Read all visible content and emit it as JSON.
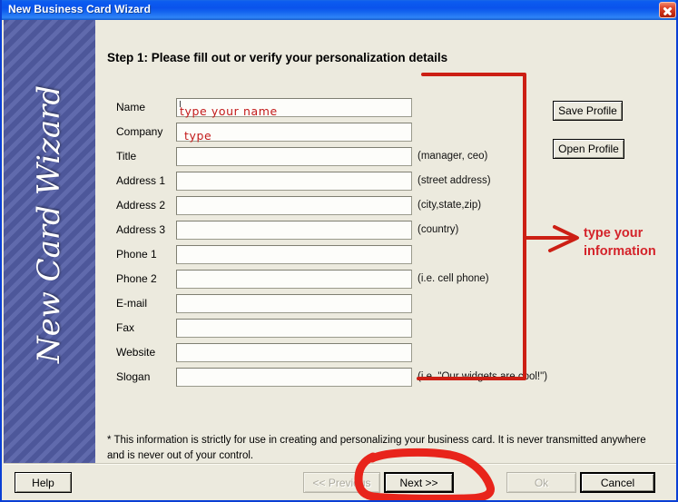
{
  "window": {
    "title": "New Business Card Wizard",
    "close_icon": "close-icon",
    "sidebar_title": "New Card Wizard",
    "accent_titlebar": "#0a53ec",
    "accent_annotation": "#d4232a",
    "panel_bg": "#eceade",
    "sidebar_bg": "#535ea6"
  },
  "main": {
    "step_heading": "Step 1:  Please fill out or verify your personalization details",
    "footnote": "* This information is strictly for use in creating and personalizing your business card.  It is never transmitted anywhere and is never out of your control."
  },
  "form": {
    "fields": [
      {
        "label": "Name",
        "value": "",
        "placeholder": "",
        "hint": ""
      },
      {
        "label": "Company",
        "value": "",
        "placeholder": "",
        "hint": ""
      },
      {
        "label": "Title",
        "value": "",
        "placeholder": "",
        "hint": "(manager, ceo)"
      },
      {
        "label": "Address 1",
        "value": "",
        "placeholder": "",
        "hint": "(street address)"
      },
      {
        "label": "Address 2",
        "value": "",
        "placeholder": "",
        "hint": "(city,state,zip)"
      },
      {
        "label": "Address 3",
        "value": "",
        "placeholder": "",
        "hint": "(country)"
      },
      {
        "label": "Phone 1",
        "value": "",
        "placeholder": "",
        "hint": ""
      },
      {
        "label": "Phone 2",
        "value": "",
        "placeholder": "",
        "hint": "(i.e. cell phone)"
      },
      {
        "label": "E-mail",
        "value": "",
        "placeholder": "",
        "hint": ""
      },
      {
        "label": "Fax",
        "value": "",
        "placeholder": "",
        "hint": ""
      },
      {
        "label": "Website",
        "value": "",
        "placeholder": "",
        "hint": ""
      },
      {
        "label": "Slogan",
        "value": "",
        "placeholder": "",
        "hint": "(i.e. \"Our widgets are cool!\")"
      }
    ]
  },
  "profile_buttons": {
    "save_label": "Save Profile",
    "open_label": "Open Profile"
  },
  "footer_buttons": {
    "help": "Help",
    "previous": "<< Previous",
    "next": "Next >>",
    "ok": "Ok",
    "cancel": "Cancel"
  },
  "annotations": {
    "color": "#d4232a",
    "type_your_name": "type your name",
    "type": "type",
    "callout_line1": "type your",
    "callout_line2": "information"
  }
}
